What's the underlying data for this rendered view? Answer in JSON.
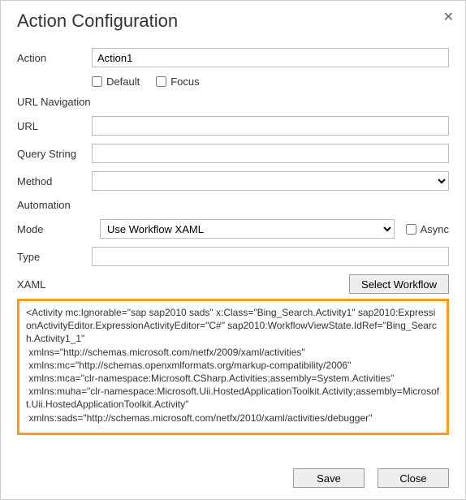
{
  "title": "Action Configuration",
  "labels": {
    "action": "Action",
    "default": "Default",
    "focus": "Focus",
    "url_nav": "URL Navigation",
    "url": "URL",
    "query_string": "Query String",
    "method": "Method",
    "automation": "Automation",
    "mode": "Mode",
    "async": "Async",
    "type": "Type",
    "xaml": "XAML",
    "select_workflow": "Select Workflow",
    "save": "Save",
    "close": "Close"
  },
  "fields": {
    "action": "Action1",
    "default_checked": false,
    "focus_checked": false,
    "url": "",
    "query_string": "",
    "method": "",
    "mode": "Use Workflow XAML",
    "async_checked": false,
    "type": ""
  },
  "xaml_content": "<Activity mc:Ignorable=\"sap sap2010 sads\" x:Class=\"Bing_Search.Activity1\" sap2010:ExpressionActivityEditor.ExpressionActivityEditor=\"C#\" sap2010:WorkflowViewState.IdRef=\"Bing_Search.Activity1_1\"\n xmlns=\"http://schemas.microsoft.com/netfx/2009/xaml/activities\"\n xmlns:mc=\"http://schemas.openxmlformats.org/markup-compatibility/2006\"\n xmlns:mca=\"clr-namespace:Microsoft.CSharp.Activities;assembly=System.Activities\"\n xmlns:muha=\"clr-namespace:Microsoft.Uii.HostedApplicationToolkit.Activity;assembly=Microsoft.Uii.HostedApplicationToolkit.Activity\"\n xmlns:sads=\"http://schemas.microsoft.com/netfx/2010/xaml/activities/debugger\""
}
